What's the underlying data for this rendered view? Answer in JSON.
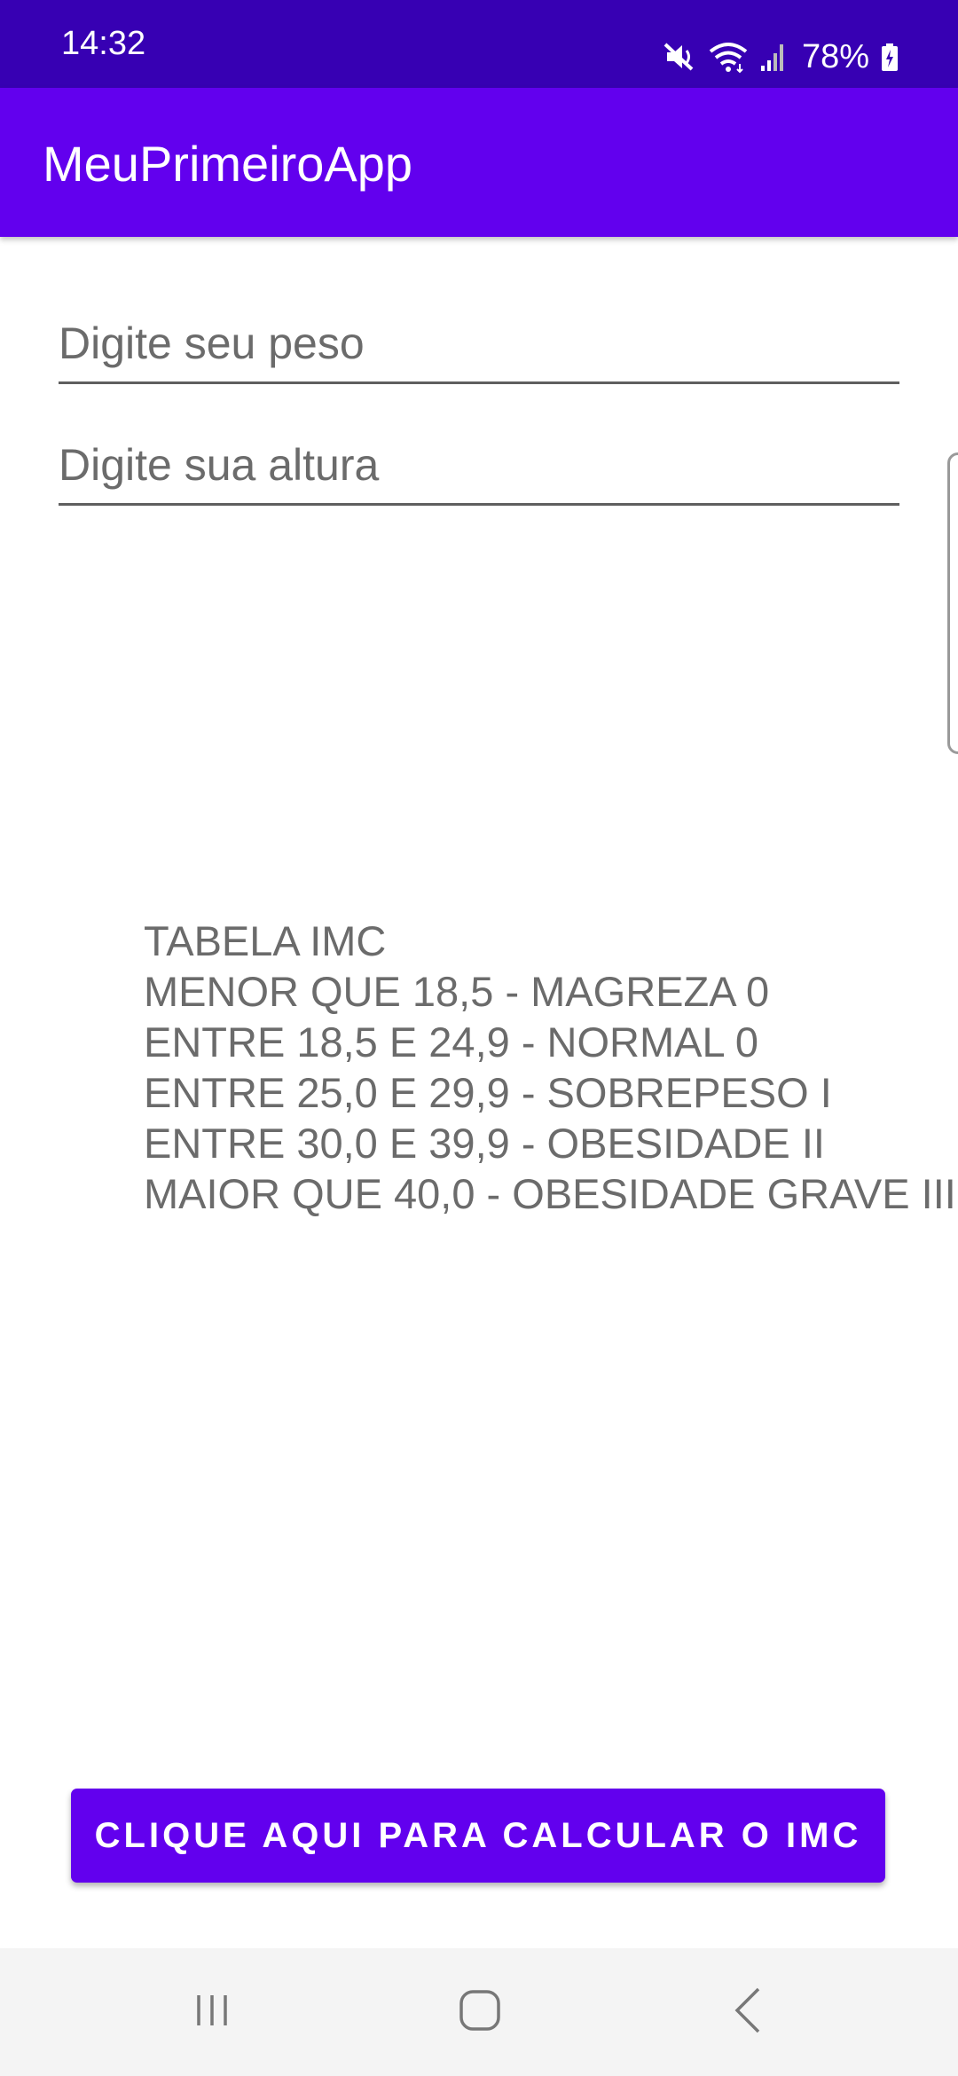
{
  "status_bar": {
    "time": "14:32",
    "battery": "78%",
    "icons": [
      "mute-icon",
      "wifi-icon",
      "signal-icon",
      "battery-charging-icon"
    ]
  },
  "app_bar": {
    "title": "MeuPrimeiroApp"
  },
  "form": {
    "weight_placeholder": "Digite seu peso",
    "height_placeholder": "Digite sua altura"
  },
  "imc_table": {
    "lines": [
      "TABELA IMC",
      "MENOR QUE 18,5 - MAGREZA 0",
      "ENTRE 18,5 E 24,9 - NORMAL 0",
      "ENTRE 25,0 E 29,9 - SOBREPESO I",
      "ENTRE 30,0 E 39,9 - OBESIDADE II",
      "MAIOR QUE 40,0 - OBESIDADE GRAVE III"
    ]
  },
  "calculate_button": {
    "label": "CLIQUE AQUI PARA CALCULAR O IMC"
  },
  "nav_bar": {
    "icons": [
      "recents-icon",
      "home-icon",
      "back-icon"
    ]
  },
  "colors": {
    "status_bar": "#3700b3",
    "primary": "#6200ee",
    "text_gray": "#6b6b6b",
    "nav_bg": "#f4f4f4"
  }
}
